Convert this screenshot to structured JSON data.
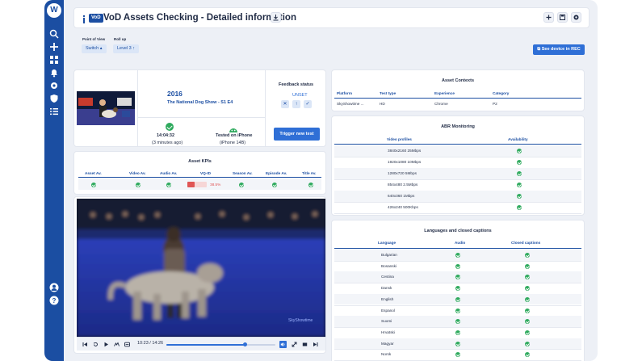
{
  "app": {
    "logo_letter": "W"
  },
  "header": {
    "badge": "VoD",
    "title": "VoD Assets Checking - Detailed information"
  },
  "filters": {
    "point_of_view": {
      "label": "Point of View",
      "value": "Switch"
    },
    "roll_up": {
      "label": "Roll up",
      "value": "Level 3"
    }
  },
  "rec_button": "See device in REC",
  "asset": {
    "year": "2016",
    "name": "The National Dog Show - S1 E4",
    "time": "14:04:32",
    "ago": "(3 minutes ago)",
    "tested_on": "Tested on iPhone",
    "device": "(iPhone 14B)"
  },
  "feedback": {
    "title": "Feedback status",
    "status": "UNSET",
    "buttons": [
      "✕",
      "↑",
      "✓"
    ],
    "trigger": "Trigger new test"
  },
  "asset_kpis": {
    "title": "Asset KPIs",
    "columns": [
      "Asset Av.",
      "Video Av.",
      "Audio Av.",
      "VQ-ID",
      "Season Av.",
      "Episode Av.",
      "Title Av."
    ],
    "vqid_value": "38.5%",
    "vqid_level": 0.385
  },
  "asset_contexts": {
    "title": "Asset Contexts",
    "columns": [
      "Platform",
      "Test type",
      "Experience",
      "Category"
    ],
    "row": [
      "SkyShowtime ...",
      "HD",
      "Chrome",
      "P2"
    ]
  },
  "abr": {
    "title": "ABR Monitoring",
    "columns": [
      "Video profiles",
      "Availability"
    ],
    "rows": [
      "3840x2160 25Mbps",
      "1920x1080 10Mbps",
      "1280x720 5Mbps",
      "854x480 2.5Mbps",
      "640x360 1Mbps",
      "426x240 500Kbps"
    ]
  },
  "languages": {
    "title": "Languages and closed captions",
    "columns": [
      "Language",
      "Audio",
      "Closed captions"
    ],
    "rows": [
      "Bulgarian",
      "Bosanski",
      "Cestina",
      "Dansk",
      "English",
      "Espanol",
      "Suomi",
      "Hrvatski",
      "Magyar",
      "Norsk"
    ]
  },
  "player": {
    "time": "10:23 / 14:26",
    "progress": 0.72,
    "watermark": "SkyShowtime"
  },
  "colors": {
    "accent": "#1b4ea2",
    "button": "#2f6fd6",
    "ok": "#2faa5e",
    "warn": "#e05555"
  }
}
